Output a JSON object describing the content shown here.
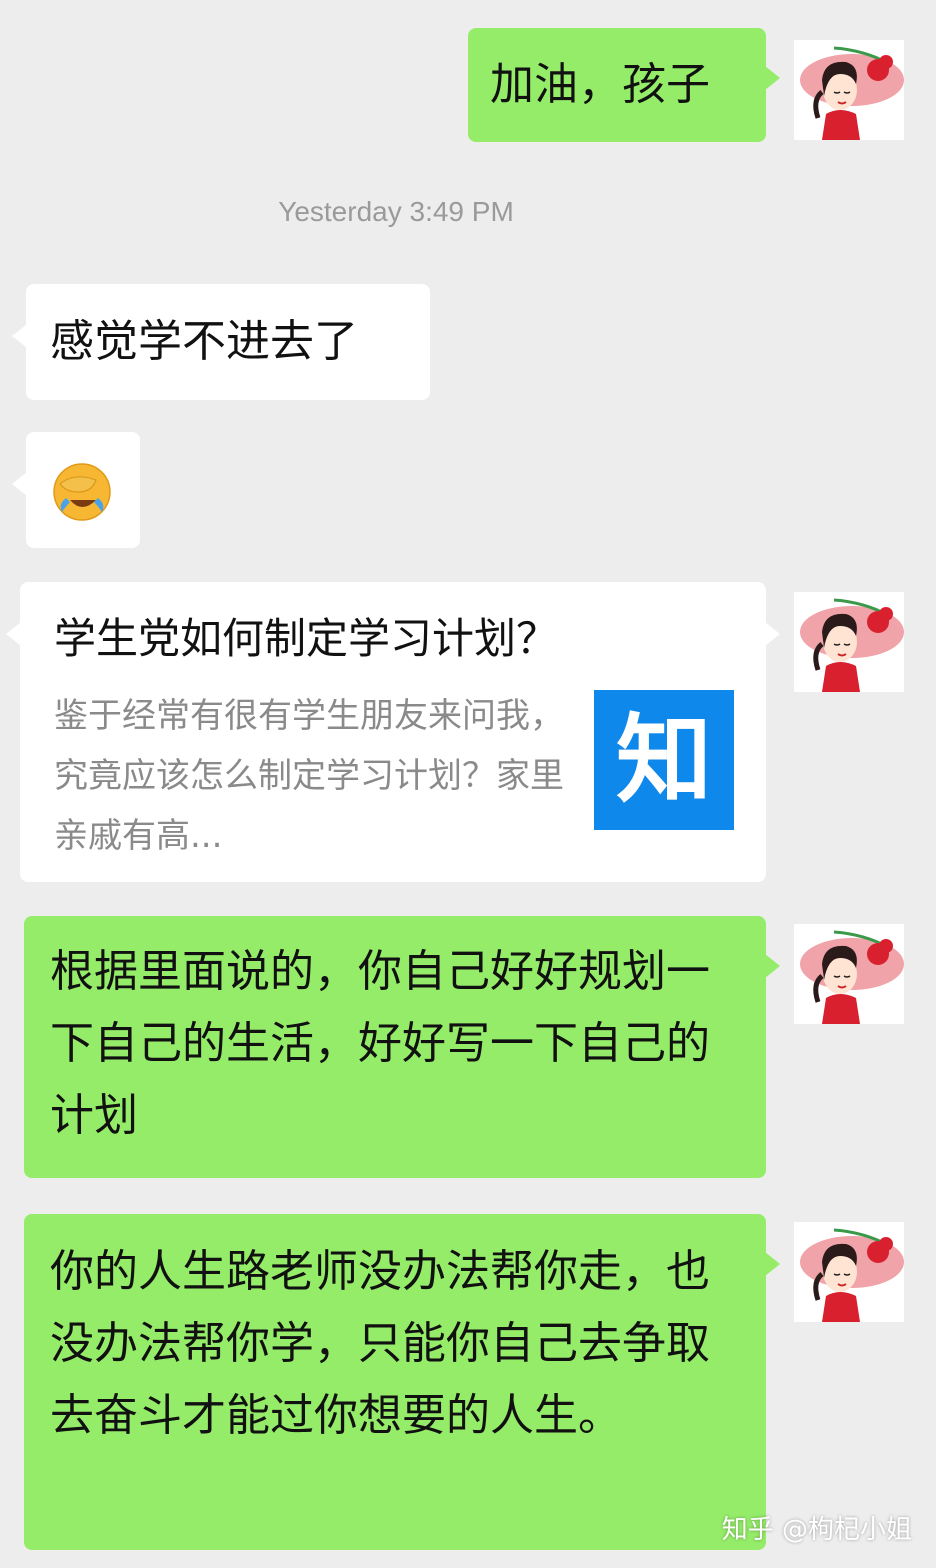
{
  "chat": {
    "timestamp": "Yesterday 3:49 PM",
    "messages": [
      {
        "sender": "me",
        "text": "加油，孩子"
      },
      {
        "sender": "them",
        "text": "感觉学不进去了"
      },
      {
        "sender": "them",
        "emoji": "face-with-hand-over-eyes-crying-laughing"
      },
      {
        "sender": "me",
        "type": "link",
        "title": "学生党如何制定学习计划？",
        "description": "鉴于经常有很有学生朋友来问我，究竟应该怎么制定学习计划？家里亲戚有高...",
        "source_logo_text": "知"
      },
      {
        "sender": "me",
        "text": "根据里面说的，你自己好好规划一下自己的生活，好好写一下自己的计划"
      },
      {
        "sender": "me",
        "text": "你的人生路老师没办法帮你走，也没办法帮你学，只能你自己去争取去奋斗才能过你想要的人生。"
      }
    ]
  },
  "watermark": "知乎 @枸杞小姐",
  "colors": {
    "background": "#ededed",
    "my_bubble": "#95ec69",
    "their_bubble": "#ffffff",
    "timestamp": "#9a9a9a",
    "zhihu_blue": "#0f88eb"
  },
  "icons": {
    "avatar": "woman-with-red-flower-hat-avatar",
    "emoji": "crying-laughing-facepalm-emoji"
  }
}
